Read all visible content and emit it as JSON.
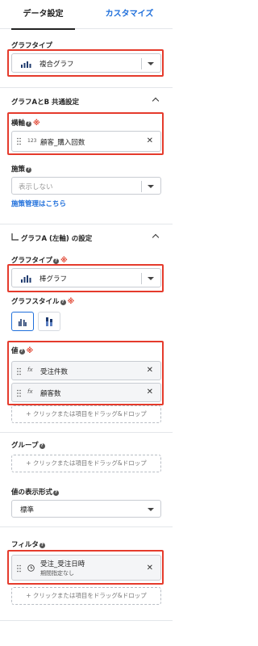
{
  "tabs": {
    "design": "データ設定",
    "customize": "カスタマイズ"
  },
  "graph_type_top": {
    "label": "グラフタイプ",
    "value": "複合グラフ"
  },
  "common": {
    "title": "グラフAとB 共通設定",
    "x_axis": {
      "label": "横軸",
      "type_tag": "123",
      "value": "顧客_購入回数"
    },
    "measure": {
      "label": "施策",
      "placeholder": "表示しない",
      "link": "施策管理はこちら"
    }
  },
  "graph_a": {
    "title": "グラフA (左軸) の設定",
    "type": {
      "label": "グラフタイプ",
      "value": "棒グラフ"
    },
    "style": {
      "label": "グラフスタイル"
    },
    "values": {
      "label": "値",
      "items": [
        {
          "type_tag": "fx",
          "text": "受注件数"
        },
        {
          "type_tag": "fx",
          "text": "顧客数"
        }
      ],
      "drop": "+ クリックまたは項目をドラッグ&ドロップ"
    },
    "group": {
      "label": "グループ",
      "drop": "+ クリックまたは項目をドラッグ&ドロップ"
    },
    "format": {
      "label": "値の表示形式",
      "value": "標準"
    },
    "filter": {
      "label": "フィルタ",
      "item": {
        "text": "受注_受注日時",
        "sub": "期間指定なし"
      },
      "drop": "+ クリックまたは項目をドラッグ&ドロップ"
    }
  },
  "required_mark": "※",
  "help_mark": "?",
  "colors": {
    "accent": "#1f6fdb",
    "highlight": "#e53b2c",
    "required": "#e0402c"
  }
}
